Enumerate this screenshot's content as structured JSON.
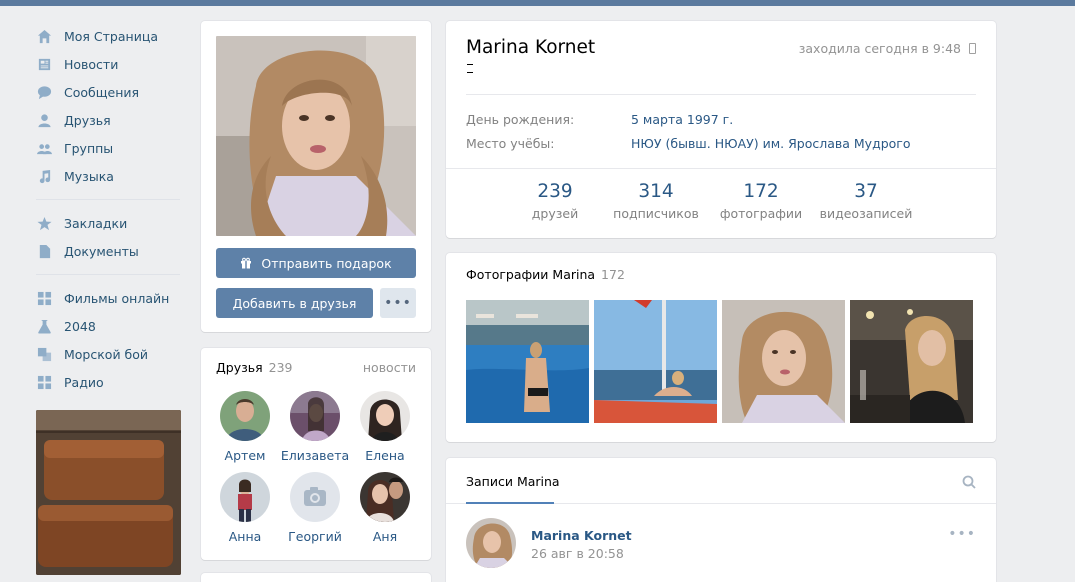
{
  "nav": {
    "items": [
      {
        "label": "Моя Страница",
        "icon": "home-icon"
      },
      {
        "label": "Новости",
        "icon": "news-icon"
      },
      {
        "label": "Сообщения",
        "icon": "messages-icon"
      },
      {
        "label": "Друзья",
        "icon": "friends-icon"
      },
      {
        "label": "Группы",
        "icon": "groups-icon"
      },
      {
        "label": "Музыка",
        "icon": "music-icon"
      }
    ],
    "items2": [
      {
        "label": "Закладки",
        "icon": "star-icon"
      },
      {
        "label": "Документы",
        "icon": "document-icon"
      }
    ],
    "items3": [
      {
        "label": "Фильмы онлайн",
        "icon": "app-grid-icon"
      },
      {
        "label": "2048",
        "icon": "flask-icon"
      },
      {
        "label": "Морской бой",
        "icon": "game-icon"
      },
      {
        "label": "Радио",
        "icon": "app-grid-icon"
      }
    ]
  },
  "avatar": {
    "gift_button": "Отправить подарок",
    "add_friend_button": "Добавить в друзья",
    "more_button": "•••"
  },
  "friends": {
    "title": "Друзья",
    "count": "239",
    "news_link": "новости",
    "list": [
      {
        "name": "Артем"
      },
      {
        "name": "Елизавета"
      },
      {
        "name": "Елена"
      },
      {
        "name": "Анна"
      },
      {
        "name": "Георгий"
      },
      {
        "name": "Аня"
      }
    ]
  },
  "profile": {
    "name": "Marina Kornet",
    "online": "заходила сегодня в 9:48",
    "birthday_label": "День рождения:",
    "birthday_value": "5 марта 1997 г.",
    "study_label": "Место учёбы:",
    "study_value": "НЮУ (бывш. НЮАУ) им. Ярослава Мудрого",
    "counters": [
      {
        "number": "239",
        "label": "друзей"
      },
      {
        "number": "314",
        "label": "подписчиков"
      },
      {
        "number": "172",
        "label": "фотографии"
      },
      {
        "number": "37",
        "label": "видеозаписей"
      }
    ]
  },
  "photos": {
    "title": "Фотографии Marina",
    "count": "172"
  },
  "wall": {
    "tab": "Записи Marina",
    "post_author": "Marina Kornet",
    "post_date": "26 авг в 20:58",
    "post_more": "•••"
  },
  "colors": {
    "accent": "#5e81a8",
    "link": "#2a5885",
    "background": "#edeef0"
  }
}
